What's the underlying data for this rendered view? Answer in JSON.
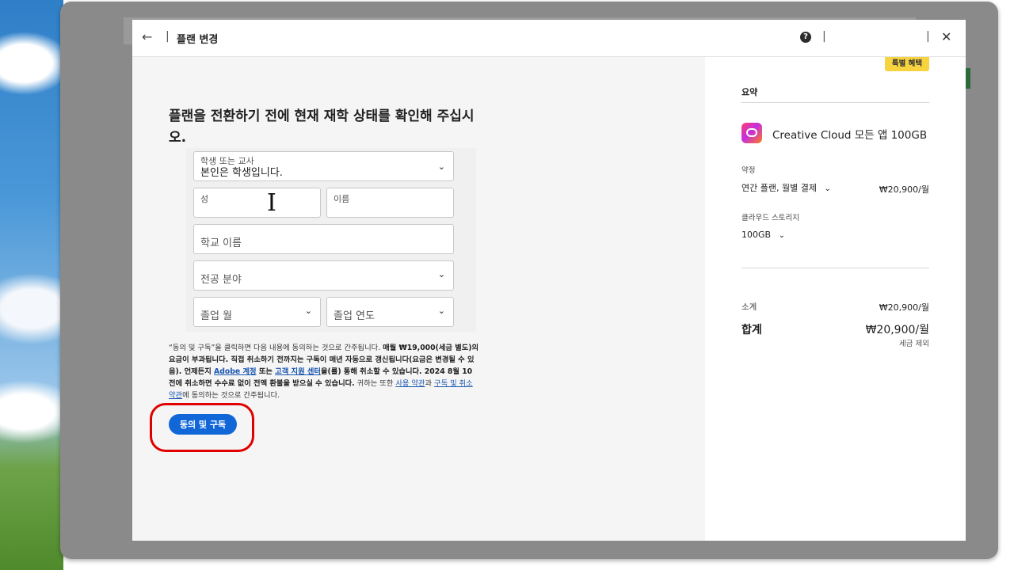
{
  "header": {
    "title": "플랜 변경",
    "separator": "|",
    "help_glyph": "?"
  },
  "form": {
    "heading": "플랜을 전환하기 전에 현재 재학 상태를 확인해 주십시오.",
    "role": {
      "label": "학생 또는 교사",
      "value": "본인은 학생입니다."
    },
    "last_name": {
      "label": "성"
    },
    "first_name": {
      "label": "이름"
    },
    "school_name": {
      "placeholder": "학교 이름"
    },
    "major": {
      "placeholder": "전공 분야"
    },
    "grad_month": {
      "placeholder": "졸업 월"
    },
    "grad_year": {
      "placeholder": "졸업 연도"
    }
  },
  "legal": {
    "p1": "“동의 및 구독”을 클릭하면 다음 내용에 동의하는 것으로 간주됩니다. ",
    "p2": "매월 ₩19,000(세금 별도)의 요금이 부과됩니다. 직접 취소하기 전까지는 구독이 매년 자동으로 갱신됩니다(요금은 변경될 수 있음). 언제든지 ",
    "link_account": "Adobe 계정",
    "p3": " 또는 ",
    "link_support": "고객 지원 센터",
    "p4": "을(를) 통해 취소할 수 있습니다. 2024 8월 10 전에 취소하면 수수료 없이 전액 환불을 받으실 수 있습니다.",
    "p5": " 귀하는 또한 ",
    "link_terms": "사용 약관",
    "p6": "과 ",
    "link_cancel": "구독 및 취소 약관",
    "p7": "에 동의하는 것으로 간주됩니다."
  },
  "agree_button": "동의 및 구독",
  "summary": {
    "badge": "특별 혜택",
    "title": "요약",
    "product": "Creative Cloud 모든 앱 100GB",
    "term_label": "약정",
    "term_value": "연간 플랜, 월별 결제",
    "term_price": "₩20,900/월",
    "storage_label": "클라우드 스토리지",
    "storage_value": "100GB",
    "subtotal_label": "소계",
    "subtotal_price": "₩20,900/월",
    "total_label": "합계",
    "total_price": "₩20,900/월",
    "tax_note": "세금 제외"
  },
  "icons": {
    "back": "arrow-left-icon",
    "help": "help-icon",
    "close": "close-icon",
    "chevron": "chevron-down-icon",
    "product": "creative-cloud-icon",
    "cursor": "text-cursor-icon"
  },
  "colors": {
    "primary_button": "#1167d8",
    "badge": "#f7d33f",
    "highlight": "#e00000",
    "link": "#1a56b0"
  }
}
